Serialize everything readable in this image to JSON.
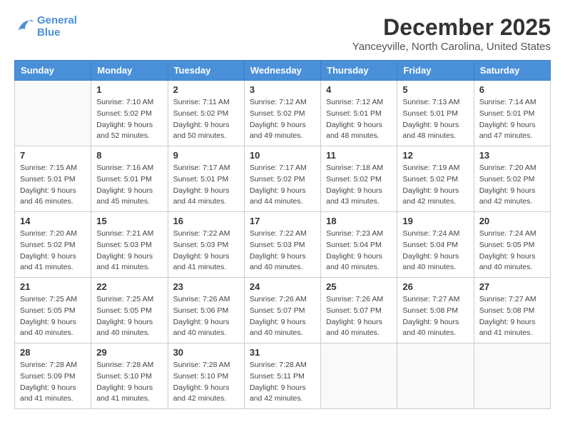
{
  "logo": {
    "line1": "General",
    "line2": "Blue"
  },
  "title": "December 2025",
  "location": "Yanceyville, North Carolina, United States",
  "weekdays": [
    "Sunday",
    "Monday",
    "Tuesday",
    "Wednesday",
    "Thursday",
    "Friday",
    "Saturday"
  ],
  "weeks": [
    [
      {
        "day": "",
        "info": ""
      },
      {
        "day": "1",
        "info": "Sunrise: 7:10 AM\nSunset: 5:02 PM\nDaylight: 9 hours\nand 52 minutes."
      },
      {
        "day": "2",
        "info": "Sunrise: 7:11 AM\nSunset: 5:02 PM\nDaylight: 9 hours\nand 50 minutes."
      },
      {
        "day": "3",
        "info": "Sunrise: 7:12 AM\nSunset: 5:02 PM\nDaylight: 9 hours\nand 49 minutes."
      },
      {
        "day": "4",
        "info": "Sunrise: 7:12 AM\nSunset: 5:01 PM\nDaylight: 9 hours\nand 48 minutes."
      },
      {
        "day": "5",
        "info": "Sunrise: 7:13 AM\nSunset: 5:01 PM\nDaylight: 9 hours\nand 48 minutes."
      },
      {
        "day": "6",
        "info": "Sunrise: 7:14 AM\nSunset: 5:01 PM\nDaylight: 9 hours\nand 47 minutes."
      }
    ],
    [
      {
        "day": "7",
        "info": "Sunrise: 7:15 AM\nSunset: 5:01 PM\nDaylight: 9 hours\nand 46 minutes."
      },
      {
        "day": "8",
        "info": "Sunrise: 7:16 AM\nSunset: 5:01 PM\nDaylight: 9 hours\nand 45 minutes."
      },
      {
        "day": "9",
        "info": "Sunrise: 7:17 AM\nSunset: 5:01 PM\nDaylight: 9 hours\nand 44 minutes."
      },
      {
        "day": "10",
        "info": "Sunrise: 7:17 AM\nSunset: 5:02 PM\nDaylight: 9 hours\nand 44 minutes."
      },
      {
        "day": "11",
        "info": "Sunrise: 7:18 AM\nSunset: 5:02 PM\nDaylight: 9 hours\nand 43 minutes."
      },
      {
        "day": "12",
        "info": "Sunrise: 7:19 AM\nSunset: 5:02 PM\nDaylight: 9 hours\nand 42 minutes."
      },
      {
        "day": "13",
        "info": "Sunrise: 7:20 AM\nSunset: 5:02 PM\nDaylight: 9 hours\nand 42 minutes."
      }
    ],
    [
      {
        "day": "14",
        "info": "Sunrise: 7:20 AM\nSunset: 5:02 PM\nDaylight: 9 hours\nand 41 minutes."
      },
      {
        "day": "15",
        "info": "Sunrise: 7:21 AM\nSunset: 5:03 PM\nDaylight: 9 hours\nand 41 minutes."
      },
      {
        "day": "16",
        "info": "Sunrise: 7:22 AM\nSunset: 5:03 PM\nDaylight: 9 hours\nand 41 minutes."
      },
      {
        "day": "17",
        "info": "Sunrise: 7:22 AM\nSunset: 5:03 PM\nDaylight: 9 hours\nand 40 minutes."
      },
      {
        "day": "18",
        "info": "Sunrise: 7:23 AM\nSunset: 5:04 PM\nDaylight: 9 hours\nand 40 minutes."
      },
      {
        "day": "19",
        "info": "Sunrise: 7:24 AM\nSunset: 5:04 PM\nDaylight: 9 hours\nand 40 minutes."
      },
      {
        "day": "20",
        "info": "Sunrise: 7:24 AM\nSunset: 5:05 PM\nDaylight: 9 hours\nand 40 minutes."
      }
    ],
    [
      {
        "day": "21",
        "info": "Sunrise: 7:25 AM\nSunset: 5:05 PM\nDaylight: 9 hours\nand 40 minutes."
      },
      {
        "day": "22",
        "info": "Sunrise: 7:25 AM\nSunset: 5:05 PM\nDaylight: 9 hours\nand 40 minutes."
      },
      {
        "day": "23",
        "info": "Sunrise: 7:26 AM\nSunset: 5:06 PM\nDaylight: 9 hours\nand 40 minutes."
      },
      {
        "day": "24",
        "info": "Sunrise: 7:26 AM\nSunset: 5:07 PM\nDaylight: 9 hours\nand 40 minutes."
      },
      {
        "day": "25",
        "info": "Sunrise: 7:26 AM\nSunset: 5:07 PM\nDaylight: 9 hours\nand 40 minutes."
      },
      {
        "day": "26",
        "info": "Sunrise: 7:27 AM\nSunset: 5:08 PM\nDaylight: 9 hours\nand 40 minutes."
      },
      {
        "day": "27",
        "info": "Sunrise: 7:27 AM\nSunset: 5:08 PM\nDaylight: 9 hours\nand 41 minutes."
      }
    ],
    [
      {
        "day": "28",
        "info": "Sunrise: 7:28 AM\nSunset: 5:09 PM\nDaylight: 9 hours\nand 41 minutes."
      },
      {
        "day": "29",
        "info": "Sunrise: 7:28 AM\nSunset: 5:10 PM\nDaylight: 9 hours\nand 41 minutes."
      },
      {
        "day": "30",
        "info": "Sunrise: 7:28 AM\nSunset: 5:10 PM\nDaylight: 9 hours\nand 42 minutes."
      },
      {
        "day": "31",
        "info": "Sunrise: 7:28 AM\nSunset: 5:11 PM\nDaylight: 9 hours\nand 42 minutes."
      },
      {
        "day": "",
        "info": ""
      },
      {
        "day": "",
        "info": ""
      },
      {
        "day": "",
        "info": ""
      }
    ]
  ]
}
